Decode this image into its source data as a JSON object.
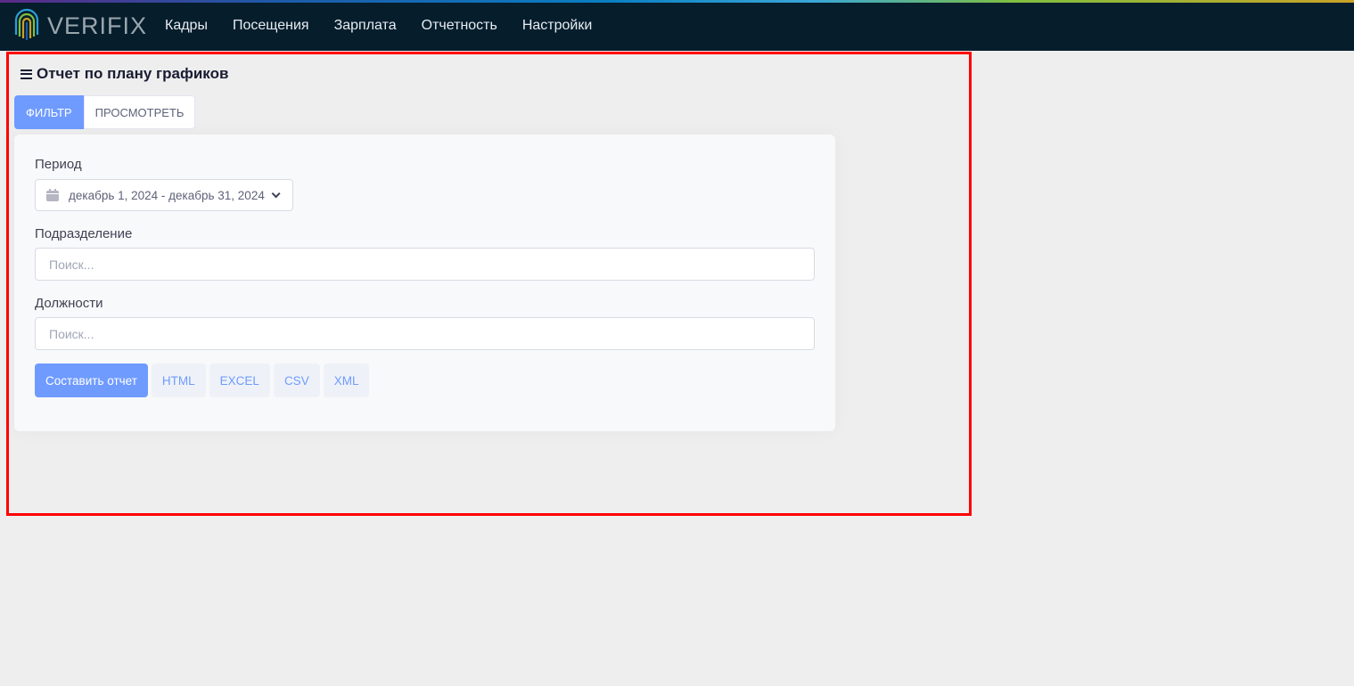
{
  "app": {
    "logo_text": "VERIFIX",
    "nav": [
      "Кадры",
      "Посещения",
      "Зарплата",
      "Отчетность",
      "Настройки"
    ]
  },
  "page": {
    "title": "Отчет по плану графиков",
    "tabs": {
      "filter": "ФИЛЬТР",
      "view": "ПРОСМОТРЕТЬ"
    }
  },
  "form": {
    "period_label": "Период",
    "period_value": "декабрь 1, 2024 - декабрь 31, 2024",
    "division_label": "Подразделение",
    "division_placeholder": "Поиск...",
    "positions_label": "Должности",
    "positions_placeholder": "Поиск..."
  },
  "actions": {
    "build_report": "Составить отчет",
    "html": "HTML",
    "excel": "EXCEL",
    "csv": "CSV",
    "xml": "XML"
  },
  "colors": {
    "accent": "#6f9bff",
    "nav_bg": "#061d2c",
    "highlight": "#ff0000"
  },
  "icons": [
    "fingerprint-logo-icon",
    "menu-icon",
    "calendar-icon",
    "chevron-down-icon"
  ]
}
